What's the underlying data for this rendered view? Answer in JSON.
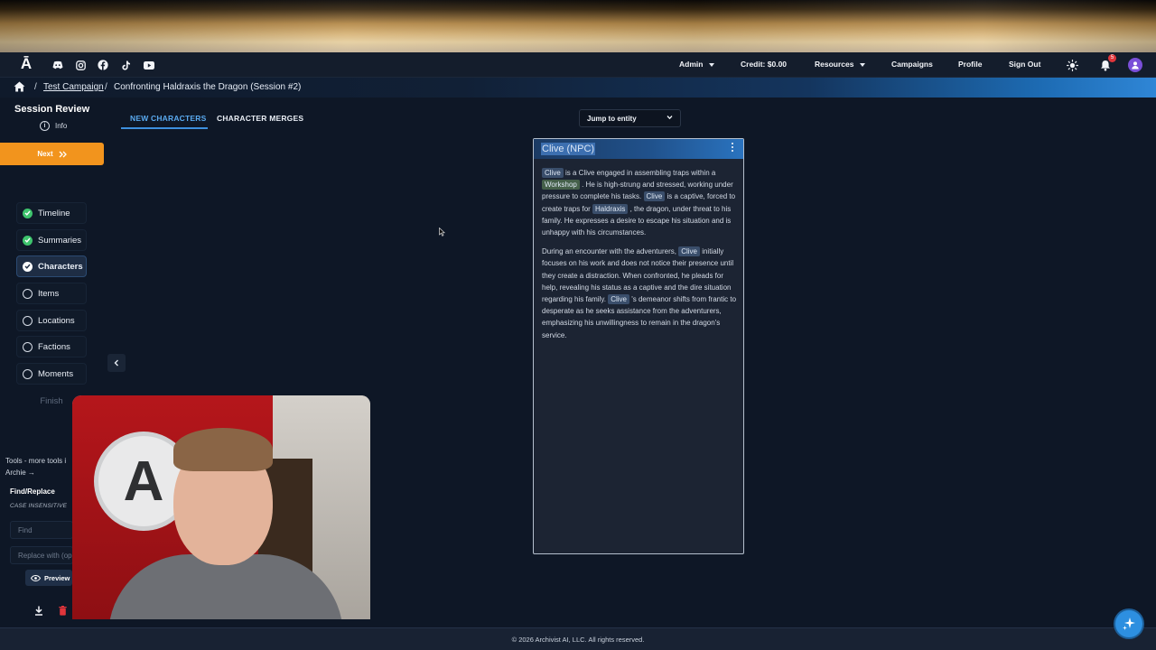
{
  "nav": {
    "logo": "Ā",
    "admin": "Admin",
    "credit": "Credit: $0.00",
    "resources": "Resources",
    "campaigns": "Campaigns",
    "profile": "Profile",
    "signout": "Sign Out",
    "notifications_count": "5"
  },
  "breadcrumb": {
    "separator": "/",
    "campaign": "Test Campaign",
    "session": "Confronting Haldraxis the Dragon (Session #2)"
  },
  "sidebar": {
    "title": "Session Review",
    "info": "Info",
    "next": "Next",
    "steps": [
      {
        "label": "Timeline",
        "done": true
      },
      {
        "label": "Summaries",
        "done": true
      },
      {
        "label": "Characters",
        "done": true
      },
      {
        "label": "Items",
        "done": false
      },
      {
        "label": "Locations",
        "done": false
      },
      {
        "label": "Factions",
        "done": false
      },
      {
        "label": "Moments",
        "done": false
      }
    ],
    "finish": "Finish",
    "tools_note": "Tools - more tools i Archie →",
    "find_replace": "Find/Replace",
    "case_note": "CASE INSENSITIVE",
    "find_placeholder": "Find",
    "replace_placeholder": "Replace with (op",
    "preview": "Preview"
  },
  "tabs": {
    "new_characters": "NEW CHARACTERS",
    "character_merges": "CHARACTER MERGES"
  },
  "jump": {
    "label": "Jump to entity"
  },
  "card": {
    "title": "Clive (NPC)",
    "tags": {
      "clive": "Clive",
      "workshop": "Workshop",
      "haldraxis": "Haldraxis"
    },
    "p1": {
      "a": " is a Clive engaged in assembling traps within a ",
      "b": " . He is high-strung and stressed, working under pressure to complete his tasks. ",
      "c": " is a captive, forced to create traps for ",
      "d": " , the dragon, under threat to his family. He expresses a desire to escape his situation and is unhappy with his circumstances."
    },
    "p2": {
      "a": "During an encounter with the adventurers, ",
      "b": " initially focuses on his work and does not notice their presence until they create a distraction. When confronted, he pleads for help, revealing his status as a captive and the dire situation regarding his family. ",
      "c": " 's demeanor shifts from frantic to desperate as he seeks assistance from the adventurers, emphasizing his unwillingness to remain in the dragon's service."
    }
  },
  "webcam": {
    "logo_letter": "A"
  },
  "footer": {
    "copyright": "© 2026 Archivist AI, LLC. All rights reserved."
  },
  "colors": {
    "accent": "#2d8fe0",
    "next_button": "#f2941d",
    "done_check": "#3ec46d",
    "background": "#0e1726"
  }
}
